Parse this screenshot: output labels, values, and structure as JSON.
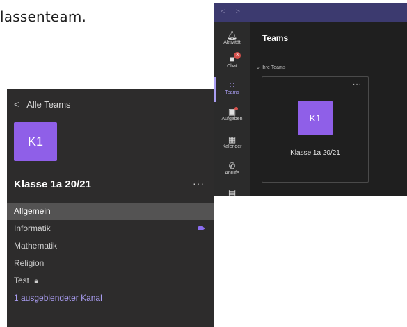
{
  "document": {
    "text": "lassenteam."
  },
  "left_panel": {
    "back_label": "Alle Teams",
    "team_initials": "K1",
    "team_name": "Klasse 1a 20/21",
    "more_label": "···",
    "channels": [
      {
        "label": "Allgemein"
      },
      {
        "label": "Informatik"
      },
      {
        "label": "Mathematik"
      },
      {
        "label": "Religion"
      },
      {
        "label": "Test"
      },
      {
        "label": "1 ausgeblendeter Kanal"
      }
    ]
  },
  "right_panel": {
    "nav_arrows": "< >",
    "rail": [
      {
        "label": "Aktivität",
        "icon": "bell-icon"
      },
      {
        "label": "Chat",
        "icon": "chat-icon",
        "badge": "3"
      },
      {
        "label": "Teams",
        "icon": "teams-icon"
      },
      {
        "label": "Aufgaben",
        "icon": "assignments-icon"
      },
      {
        "label": "Kalender",
        "icon": "calendar-icon"
      },
      {
        "label": "Anrufe",
        "icon": "phone-icon"
      }
    ],
    "title": "Teams",
    "section_label": "Ihre Teams",
    "card": {
      "initials": "K1",
      "name": "Klasse 1a 20/21",
      "more": "···"
    }
  },
  "colors": {
    "accent": "#8f5fe8",
    "rail_active": "#a99df2",
    "titlebar": "#3c3a6f"
  }
}
